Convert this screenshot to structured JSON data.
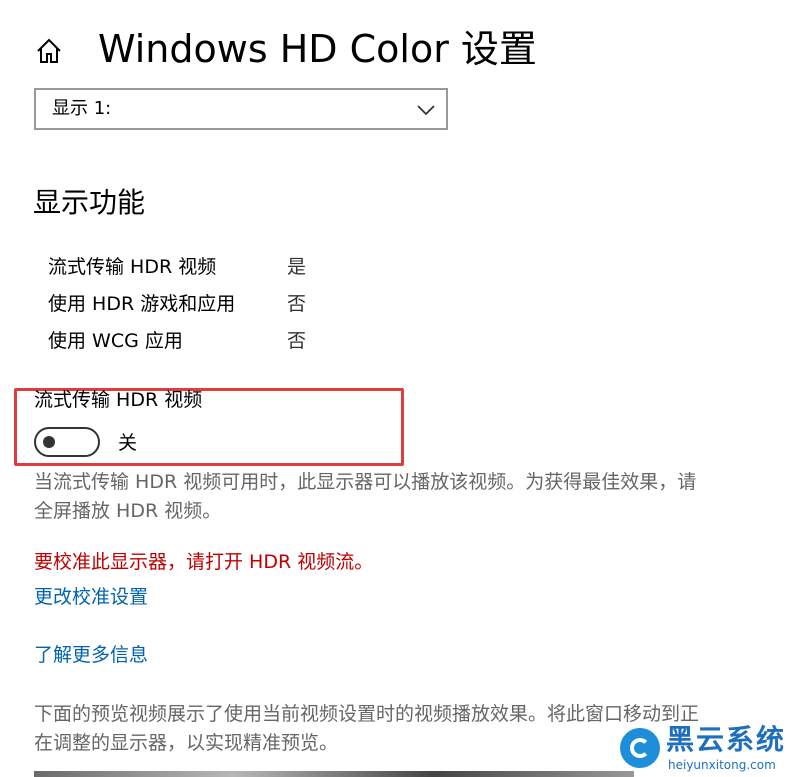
{
  "header": {
    "title": "Windows HD Color 设置",
    "home_icon": "home-icon"
  },
  "display_select": {
    "selected": "显示 1:",
    "icon": "chevron-down-icon"
  },
  "section": {
    "heading": "显示功能"
  },
  "capabilities": [
    {
      "label": "流式传输 HDR 视频",
      "value": "是"
    },
    {
      "label": "使用 HDR 游戏和应用",
      "value": "否"
    },
    {
      "label": "使用 WCG 应用",
      "value": "否"
    }
  ],
  "stream_hdr": {
    "title": "流式传输 HDR 视频",
    "state": "关",
    "on": false
  },
  "description": "当流式传输 HDR 视频可用时，此显示器可以播放该视频。为获得最佳效果，请全屏播放 HDR 视频。",
  "warning": "要校准此显示器，请打开 HDR 视频流。",
  "links": {
    "calibrate": "更改校准设置",
    "learn_more": "了解更多信息"
  },
  "preview_description": "下面的预览视频展示了使用当前视频设置时的视频播放效果。将此窗口移动到正在调整的显示器，以实现精准预览。",
  "watermark": {
    "name": "黑云系统",
    "url": "heiyunxitong.com"
  },
  "colors": {
    "highlight": "#e03c3c",
    "link": "#0063b1",
    "warning": "#c00000",
    "muted_text": "#666666",
    "watermark": "#1e6fbf"
  }
}
